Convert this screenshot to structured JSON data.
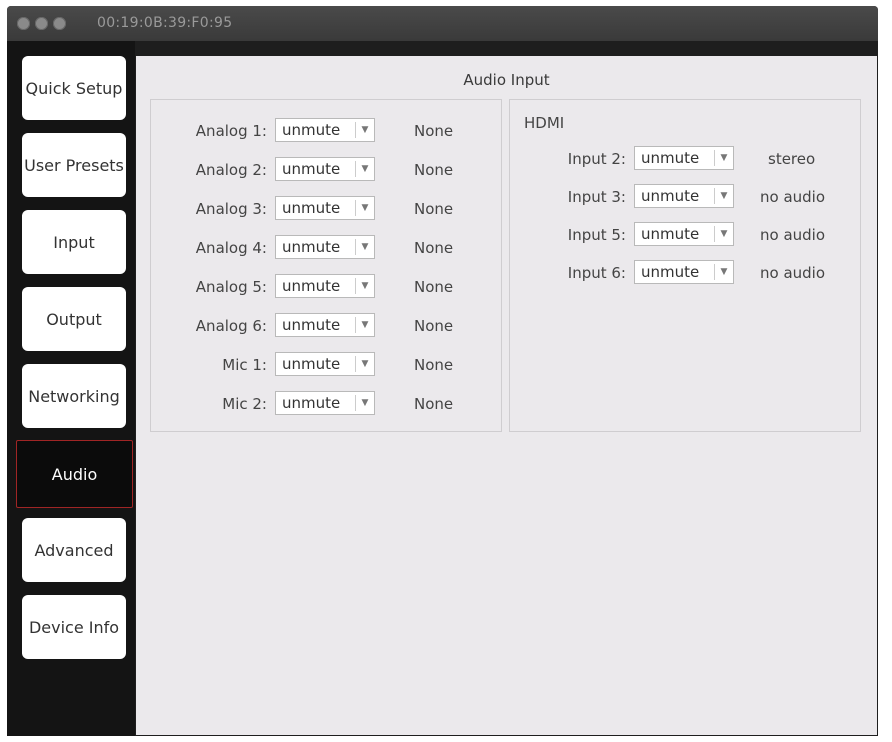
{
  "window": {
    "title": "00:19:0B:39:F0:95"
  },
  "sidebar": {
    "items": [
      {
        "label": "Quick Setup"
      },
      {
        "label": "User Presets"
      },
      {
        "label": "Input"
      },
      {
        "label": "Output"
      },
      {
        "label": "Networking"
      },
      {
        "label": "Audio"
      },
      {
        "label": "Advanced"
      },
      {
        "label": "Device Info"
      }
    ],
    "active": "Audio"
  },
  "main": {
    "title": "Audio Input",
    "analog": [
      {
        "label": "Analog 1:",
        "value": "unmute",
        "status": "None"
      },
      {
        "label": "Analog 2:",
        "value": "unmute",
        "status": "None"
      },
      {
        "label": "Analog 3:",
        "value": "unmute",
        "status": "None"
      },
      {
        "label": "Analog 4:",
        "value": "unmute",
        "status": "None"
      },
      {
        "label": "Analog 5:",
        "value": "unmute",
        "status": "None"
      },
      {
        "label": "Analog 6:",
        "value": "unmute",
        "status": "None"
      },
      {
        "label": "Mic 1:",
        "value": "unmute",
        "status": "None"
      },
      {
        "label": "Mic 2:",
        "value": "unmute",
        "status": "None"
      }
    ],
    "hdmi": {
      "title": "HDMI",
      "inputs": [
        {
          "label": "Input 2:",
          "value": "unmute",
          "status": "stereo"
        },
        {
          "label": "Input 3:",
          "value": "unmute",
          "status": "no audio"
        },
        {
          "label": "Input 5:",
          "value": "unmute",
          "status": "no audio"
        },
        {
          "label": "Input 6:",
          "value": "unmute",
          "status": "no audio"
        }
      ]
    }
  }
}
